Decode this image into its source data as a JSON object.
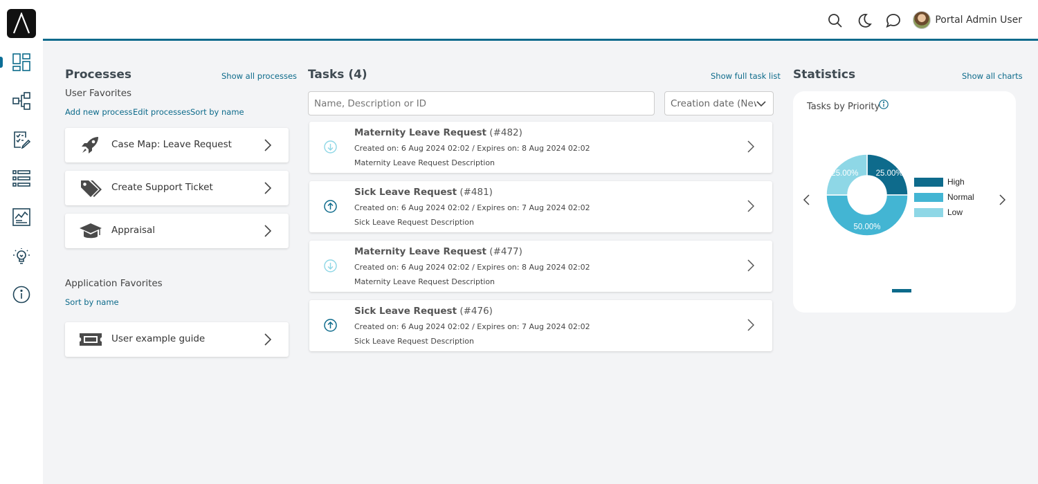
{
  "header": {
    "user_name": "Portal Admin User"
  },
  "sidebar": {
    "items": [
      {
        "icon": "dashboard-icon"
      },
      {
        "icon": "process-flow-icon"
      },
      {
        "icon": "task-checklist-icon"
      },
      {
        "icon": "list-icon"
      },
      {
        "icon": "statistics-icon"
      },
      {
        "icon": "lightbulb-icon"
      },
      {
        "icon": "info-icon"
      }
    ]
  },
  "processes": {
    "title": "Processes",
    "show_all": "Show all processes",
    "user_favorites_title": "User Favorites",
    "actions": [
      "Add new process",
      "Edit processes",
      "Sort by name"
    ],
    "items": [
      {
        "label": "Case Map: Leave Request",
        "icon": "rocket-icon"
      },
      {
        "label": "Create Support Ticket",
        "icon": "tags-icon"
      },
      {
        "label": "Appraisal",
        "icon": "graduation-cap-icon"
      }
    ],
    "app_favorites_title": "Application Favorites",
    "app_sort": "Sort by name",
    "app_items": [
      {
        "label": "User example guide",
        "icon": "ticket-icon"
      }
    ]
  },
  "tasks": {
    "title": "Tasks (4)",
    "show_full": "Show full task list",
    "search_placeholder": "Name, Description or ID",
    "sort_value": "Creation date (Newest first)",
    "items": [
      {
        "name": "Maternity Leave Request",
        "id": "(#482)",
        "meta": "Created on: 6 Aug 2024 02:02 / Expires on: 8 Aug 2024 02:02",
        "desc": "Maternity Leave Request Description",
        "priority": "low"
      },
      {
        "name": "Sick Leave Request",
        "id": "(#481)",
        "meta": "Created on: 6 Aug 2024 02:02 / Expires on: 7 Aug 2024 02:02",
        "desc": "Sick Leave Request Description",
        "priority": "high"
      },
      {
        "name": "Maternity Leave Request",
        "id": "(#477)",
        "meta": "Created on: 6 Aug 2024 02:02 / Expires on: 8 Aug 2024 02:02",
        "desc": "Maternity Leave Request Description",
        "priority": "low"
      },
      {
        "name": "Sick Leave Request",
        "id": "(#476)",
        "meta": "Created on: 6 Aug 2024 02:02 / Expires on: 7 Aug 2024 02:02",
        "desc": "Sick Leave Request Description",
        "priority": "high"
      }
    ]
  },
  "statistics": {
    "title": "Statistics",
    "show_all": "Show all charts"
  },
  "chart_data": {
    "type": "pie",
    "title": "Tasks by Priority",
    "categories": [
      "High",
      "Normal",
      "Low"
    ],
    "values": [
      25,
      50,
      25
    ],
    "labels": [
      "25.00%",
      "50.00%",
      "25.00%"
    ],
    "colors": [
      "#0e6b8c",
      "#43b5d3",
      "#8ed7e6"
    ],
    "legend": "right"
  },
  "colors": {
    "accent": "#0c6a8a"
  }
}
